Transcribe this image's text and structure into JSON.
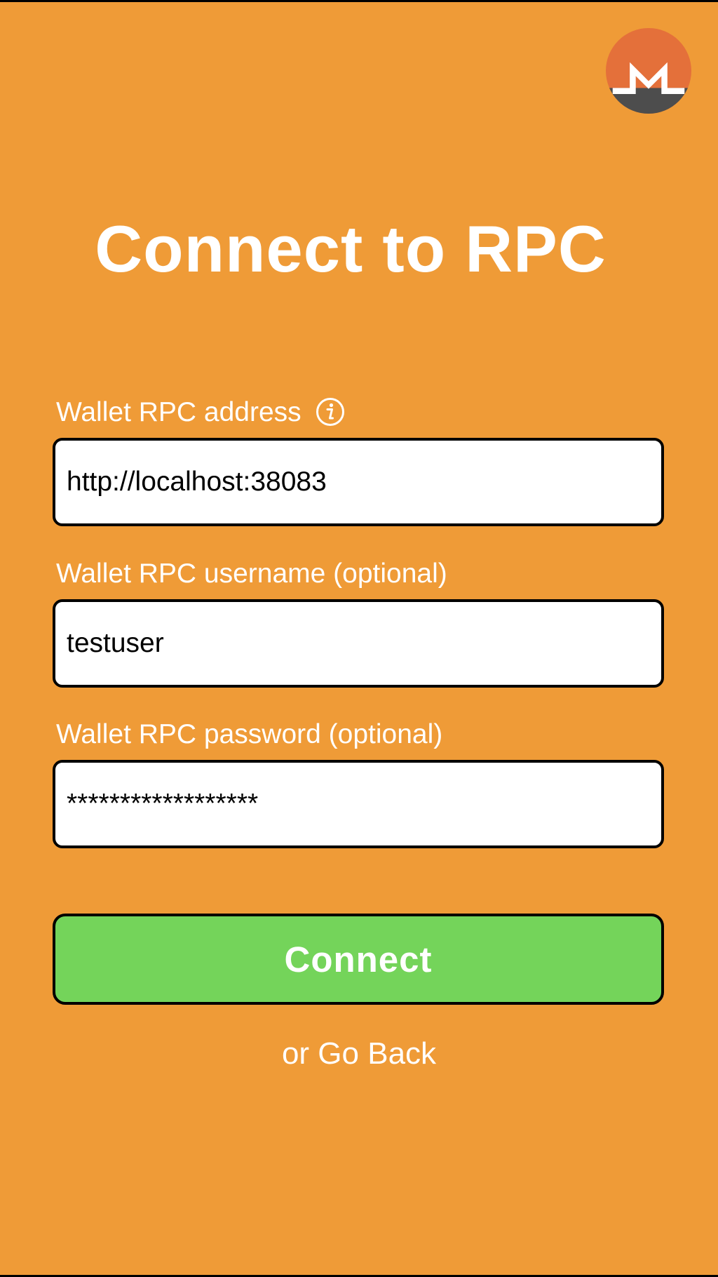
{
  "colors": {
    "background": "#ef9b37",
    "button": "#74d45a",
    "logo_orange": "#e4703a",
    "logo_gray": "#4d4d4d"
  },
  "logo": {
    "icon": "monero-logo"
  },
  "title": "Connect to RPC",
  "fields": {
    "address": {
      "label": "Wallet RPC address",
      "value": "http://localhost:38083",
      "info_icon": "info-icon"
    },
    "username": {
      "label": "Wallet RPC username (optional)",
      "value": "testuser"
    },
    "password": {
      "label": "Wallet RPC password (optional)",
      "value": "******************"
    }
  },
  "connect_button": {
    "label": "Connect"
  },
  "go_back": {
    "prefix": "or",
    "link": "Go Back"
  }
}
